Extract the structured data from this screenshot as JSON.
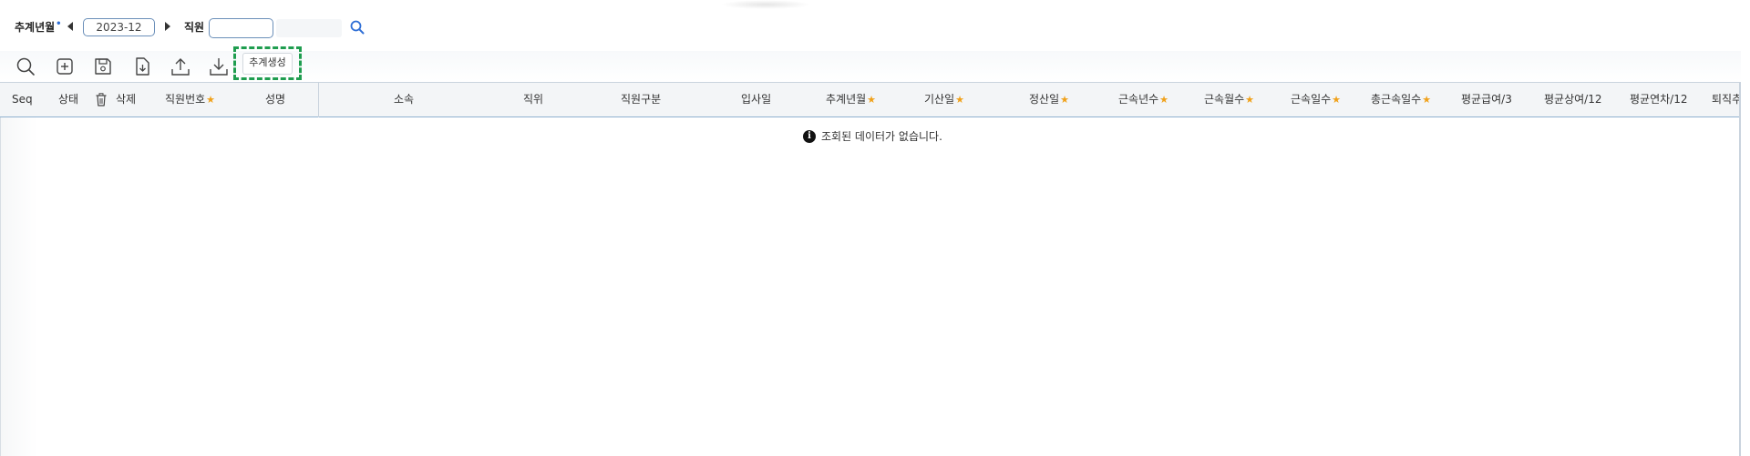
{
  "search": {
    "period_label": "추계년월",
    "period_value": "2023-12",
    "employee_label": "직원",
    "employee_value": ""
  },
  "toolbar": {
    "generate_label": "추계생성"
  },
  "grid": {
    "columns": [
      {
        "label": "Seq",
        "required": false
      },
      {
        "label": "상태",
        "required": false
      },
      {
        "label": "삭제",
        "required": false
      },
      {
        "label": "직원번호",
        "required": true
      },
      {
        "label": "성명",
        "required": false
      },
      {
        "label": "소속",
        "required": false
      },
      {
        "label": "직위",
        "required": false
      },
      {
        "label": "직원구분",
        "required": false
      },
      {
        "label": "입사일",
        "required": false
      },
      {
        "label": "추계년월",
        "required": true
      },
      {
        "label": "기산일",
        "required": true
      },
      {
        "label": "정산일",
        "required": true
      },
      {
        "label": "근속년수",
        "required": true
      },
      {
        "label": "근속월수",
        "required": true
      },
      {
        "label": "근속일수",
        "required": true
      },
      {
        "label": "총근속일수",
        "required": true
      },
      {
        "label": "평균급여/3",
        "required": false
      },
      {
        "label": "평균상여/12",
        "required": false
      },
      {
        "label": "평균연차/12",
        "required": false
      },
      {
        "label": "퇴직추",
        "required": false
      }
    ],
    "empty_message": "조회된 데이터가 없습니다."
  },
  "icons": [
    "caret-left-icon",
    "caret-right-icon",
    "search-icon",
    "search-tool-icon",
    "add-icon",
    "save-icon",
    "import-icon",
    "upload-icon",
    "download-icon",
    "trash-icon",
    "info-icon"
  ],
  "colors": {
    "accent": "#2f6fd6",
    "required_star": "#f0a11a",
    "highlight_border": "#1f9d4f",
    "input_border": "#6b8fb9"
  }
}
